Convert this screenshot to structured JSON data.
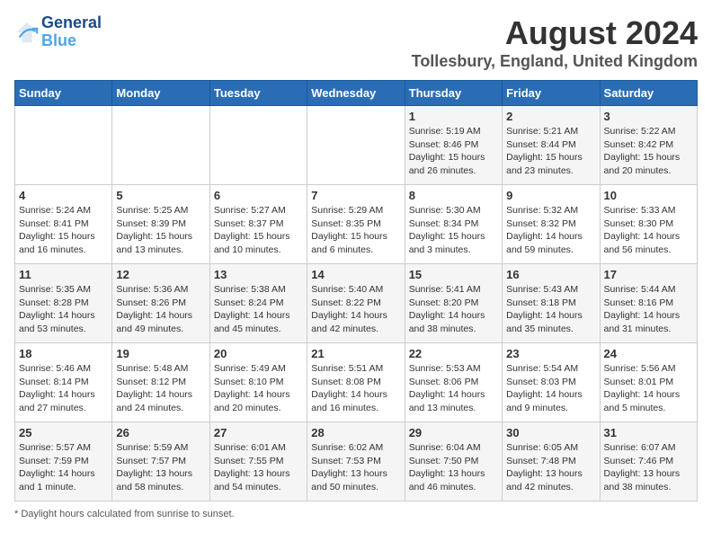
{
  "header": {
    "logo_line1": "General",
    "logo_line2": "Blue",
    "title": "August 2024",
    "subtitle": "Tollesbury, England, United Kingdom"
  },
  "days_of_week": [
    "Sunday",
    "Monday",
    "Tuesday",
    "Wednesday",
    "Thursday",
    "Friday",
    "Saturday"
  ],
  "weeks": [
    [
      {
        "day": "",
        "info": ""
      },
      {
        "day": "",
        "info": ""
      },
      {
        "day": "",
        "info": ""
      },
      {
        "day": "",
        "info": ""
      },
      {
        "day": "1",
        "info": "Sunrise: 5:19 AM\nSunset: 8:46 PM\nDaylight: 15 hours\nand 26 minutes."
      },
      {
        "day": "2",
        "info": "Sunrise: 5:21 AM\nSunset: 8:44 PM\nDaylight: 15 hours\nand 23 minutes."
      },
      {
        "day": "3",
        "info": "Sunrise: 5:22 AM\nSunset: 8:42 PM\nDaylight: 15 hours\nand 20 minutes."
      }
    ],
    [
      {
        "day": "4",
        "info": "Sunrise: 5:24 AM\nSunset: 8:41 PM\nDaylight: 15 hours\nand 16 minutes."
      },
      {
        "day": "5",
        "info": "Sunrise: 5:25 AM\nSunset: 8:39 PM\nDaylight: 15 hours\nand 13 minutes."
      },
      {
        "day": "6",
        "info": "Sunrise: 5:27 AM\nSunset: 8:37 PM\nDaylight: 15 hours\nand 10 minutes."
      },
      {
        "day": "7",
        "info": "Sunrise: 5:29 AM\nSunset: 8:35 PM\nDaylight: 15 hours\nand 6 minutes."
      },
      {
        "day": "8",
        "info": "Sunrise: 5:30 AM\nSunset: 8:34 PM\nDaylight: 15 hours\nand 3 minutes."
      },
      {
        "day": "9",
        "info": "Sunrise: 5:32 AM\nSunset: 8:32 PM\nDaylight: 14 hours\nand 59 minutes."
      },
      {
        "day": "10",
        "info": "Sunrise: 5:33 AM\nSunset: 8:30 PM\nDaylight: 14 hours\nand 56 minutes."
      }
    ],
    [
      {
        "day": "11",
        "info": "Sunrise: 5:35 AM\nSunset: 8:28 PM\nDaylight: 14 hours\nand 53 minutes."
      },
      {
        "day": "12",
        "info": "Sunrise: 5:36 AM\nSunset: 8:26 PM\nDaylight: 14 hours\nand 49 minutes."
      },
      {
        "day": "13",
        "info": "Sunrise: 5:38 AM\nSunset: 8:24 PM\nDaylight: 14 hours\nand 45 minutes."
      },
      {
        "day": "14",
        "info": "Sunrise: 5:40 AM\nSunset: 8:22 PM\nDaylight: 14 hours\nand 42 minutes."
      },
      {
        "day": "15",
        "info": "Sunrise: 5:41 AM\nSunset: 8:20 PM\nDaylight: 14 hours\nand 38 minutes."
      },
      {
        "day": "16",
        "info": "Sunrise: 5:43 AM\nSunset: 8:18 PM\nDaylight: 14 hours\nand 35 minutes."
      },
      {
        "day": "17",
        "info": "Sunrise: 5:44 AM\nSunset: 8:16 PM\nDaylight: 14 hours\nand 31 minutes."
      }
    ],
    [
      {
        "day": "18",
        "info": "Sunrise: 5:46 AM\nSunset: 8:14 PM\nDaylight: 14 hours\nand 27 minutes."
      },
      {
        "day": "19",
        "info": "Sunrise: 5:48 AM\nSunset: 8:12 PM\nDaylight: 14 hours\nand 24 minutes."
      },
      {
        "day": "20",
        "info": "Sunrise: 5:49 AM\nSunset: 8:10 PM\nDaylight: 14 hours\nand 20 minutes."
      },
      {
        "day": "21",
        "info": "Sunrise: 5:51 AM\nSunset: 8:08 PM\nDaylight: 14 hours\nand 16 minutes."
      },
      {
        "day": "22",
        "info": "Sunrise: 5:53 AM\nSunset: 8:06 PM\nDaylight: 14 hours\nand 13 minutes."
      },
      {
        "day": "23",
        "info": "Sunrise: 5:54 AM\nSunset: 8:03 PM\nDaylight: 14 hours\nand 9 minutes."
      },
      {
        "day": "24",
        "info": "Sunrise: 5:56 AM\nSunset: 8:01 PM\nDaylight: 14 hours\nand 5 minutes."
      }
    ],
    [
      {
        "day": "25",
        "info": "Sunrise: 5:57 AM\nSunset: 7:59 PM\nDaylight: 14 hours\nand 1 minute."
      },
      {
        "day": "26",
        "info": "Sunrise: 5:59 AM\nSunset: 7:57 PM\nDaylight: 13 hours\nand 58 minutes."
      },
      {
        "day": "27",
        "info": "Sunrise: 6:01 AM\nSunset: 7:55 PM\nDaylight: 13 hours\nand 54 minutes."
      },
      {
        "day": "28",
        "info": "Sunrise: 6:02 AM\nSunset: 7:53 PM\nDaylight: 13 hours\nand 50 minutes."
      },
      {
        "day": "29",
        "info": "Sunrise: 6:04 AM\nSunset: 7:50 PM\nDaylight: 13 hours\nand 46 minutes."
      },
      {
        "day": "30",
        "info": "Sunrise: 6:05 AM\nSunset: 7:48 PM\nDaylight: 13 hours\nand 42 minutes."
      },
      {
        "day": "31",
        "info": "Sunrise: 6:07 AM\nSunset: 7:46 PM\nDaylight: 13 hours\nand 38 minutes."
      }
    ]
  ],
  "footer": {
    "note": "Daylight hours"
  }
}
